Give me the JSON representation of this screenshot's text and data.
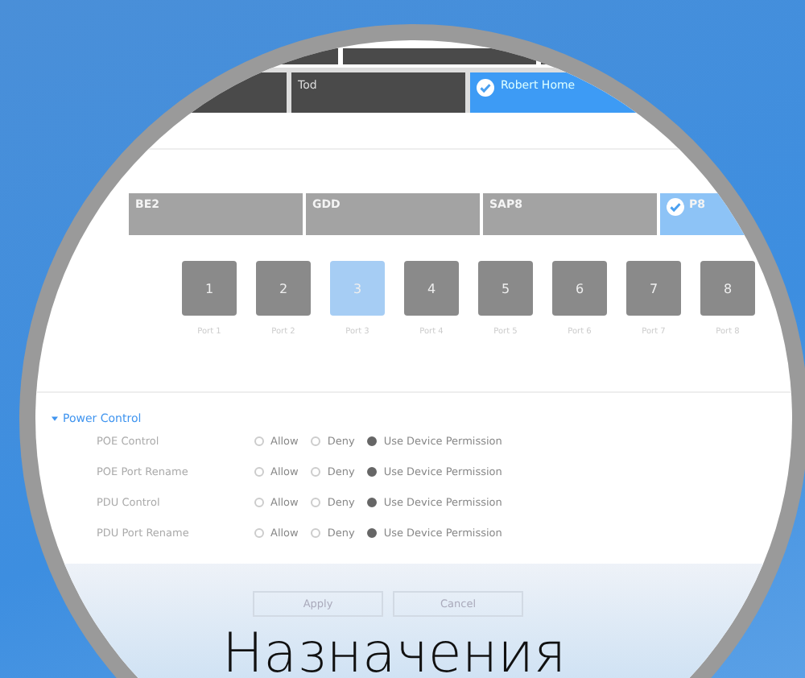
{
  "top_tabs": [
    {
      "selected": false
    },
    {
      "label": "Tod",
      "selected": false
    },
    {
      "label": "Robert Home",
      "selected": true
    }
  ],
  "devices": [
    {
      "name": "BE2",
      "selected": false
    },
    {
      "name": "GDD",
      "selected": false
    },
    {
      "name": "SAP8",
      "selected": false
    },
    {
      "name": "P8",
      "selected": true
    }
  ],
  "ports": [
    {
      "number": "1",
      "label": "Port 1",
      "selected": false
    },
    {
      "number": "2",
      "label": "Port 2",
      "selected": false
    },
    {
      "number": "3",
      "label": "Port 3",
      "selected": true
    },
    {
      "number": "4",
      "label": "Port 4",
      "selected": false
    },
    {
      "number": "5",
      "label": "Port 5",
      "selected": false
    },
    {
      "number": "6",
      "label": "Port 6",
      "selected": false
    },
    {
      "number": "7",
      "label": "Port 7",
      "selected": false
    },
    {
      "number": "8",
      "label": "Port 8",
      "selected": false
    }
  ],
  "power_control": {
    "title": "Power Control",
    "expanded": true,
    "rows": [
      {
        "label": "POE Control",
        "options": [
          {
            "label": "Allow",
            "selected": false
          },
          {
            "label": "Deny",
            "selected": false
          },
          {
            "label": "Use Device Permission",
            "selected": true
          }
        ]
      },
      {
        "label": "POE Port Rename",
        "options": [
          {
            "label": "Allow",
            "selected": false
          },
          {
            "label": "Deny",
            "selected": false
          },
          {
            "label": "Use Device Permission",
            "selected": true
          }
        ]
      },
      {
        "label": "PDU Control",
        "options": [
          {
            "label": "Allow",
            "selected": false
          },
          {
            "label": "Deny",
            "selected": false
          },
          {
            "label": "Use Device Permission",
            "selected": true
          }
        ]
      },
      {
        "label": "PDU Port Rename",
        "options": [
          {
            "label": "Allow",
            "selected": false
          },
          {
            "label": "Deny",
            "selected": false
          },
          {
            "label": "Use Device Permission",
            "selected": true
          }
        ]
      }
    ]
  },
  "buttons": [
    "Apply",
    "Cancel"
  ],
  "caption": "Назначения"
}
